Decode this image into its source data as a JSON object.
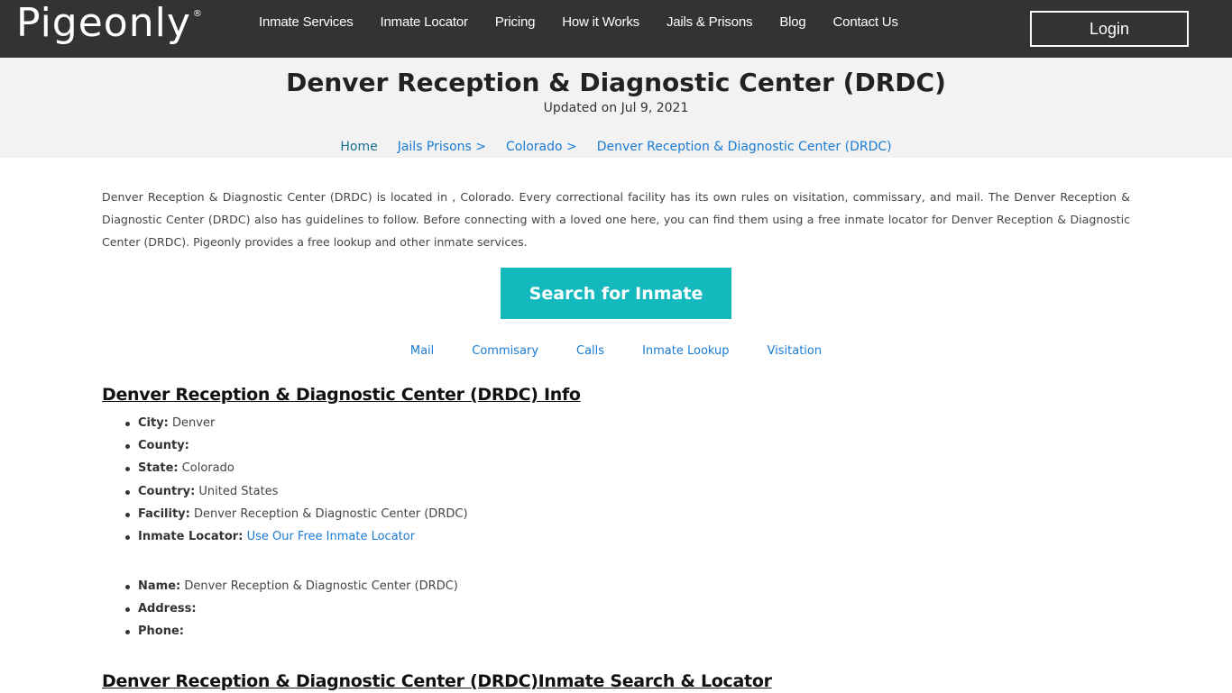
{
  "navbar": {
    "logo": "Pigeonly",
    "logo_mark": "®",
    "links": [
      {
        "label": "Inmate Services"
      },
      {
        "label": "Inmate Locator"
      },
      {
        "label": "Pricing"
      },
      {
        "label": "How it Works"
      },
      {
        "label": "Jails & Prisons"
      },
      {
        "label": "Blog"
      },
      {
        "label": "Contact Us"
      }
    ],
    "login_label": "Login"
  },
  "header": {
    "title": "Denver Reception & Diagnostic Center (DRDC)",
    "updated": "Updated on Jul 9, 2021",
    "breadcrumb": [
      {
        "label": "Home"
      },
      {
        "label": "Jails Prisons >"
      },
      {
        "label": "Colorado >"
      },
      {
        "label": "Denver Reception & Diagnostic Center (DRDC)"
      }
    ]
  },
  "main": {
    "intro": "Denver Reception & Diagnostic Center (DRDC) is located in , Colorado. Every correctional facility has its own rules on visitation, commissary, and mail. The Denver Reception & Diagnostic Center (DRDC) also has guidelines to follow. Before connecting with a loved one here, you can find them using a free inmate locator for Denver Reception & Diagnostic Center (DRDC). Pigeonly provides a free lookup and other inmate services.",
    "search_button": "Search for Inmate",
    "sub_links": [
      {
        "label": "Mail"
      },
      {
        "label": "Commisary"
      },
      {
        "label": "Calls"
      },
      {
        "label": "Inmate Lookup"
      },
      {
        "label": "Visitation"
      }
    ],
    "info_heading": "Denver Reception & Diagnostic Center (DRDC) Info",
    "info_items": [
      {
        "label": "City:",
        "value": " Denver"
      },
      {
        "label": "County:",
        "value": ""
      },
      {
        "label": "State:",
        "value": " Colorado"
      },
      {
        "label": "Country:",
        "value": " United States"
      },
      {
        "label": "Facility:",
        "value": " Denver Reception & Diagnostic Center (DRDC)"
      },
      {
        "label": "Inmate Locator:",
        "link": "Use Our Free Inmate Locator"
      }
    ],
    "contact_items": [
      {
        "label": "Name:",
        "value": " Denver Reception & Diagnostic Center (DRDC)"
      },
      {
        "label": "Address:",
        "value": ""
      },
      {
        "label": "Phone:",
        "value": ""
      }
    ],
    "search_heading": "Denver Reception & Diagnostic Center (DRDC)Inmate Search & Locator"
  },
  "colors": {
    "navbar_bg": "#333333",
    "accent_teal": "#14b9be",
    "link_blue": "#1a7bd3",
    "header_band": "#f2f2f2"
  }
}
